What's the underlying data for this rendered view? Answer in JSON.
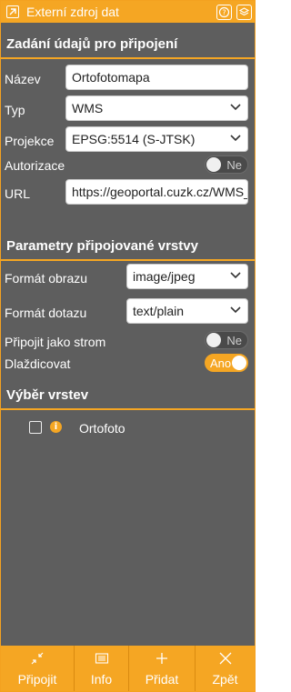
{
  "window": {
    "title": "Externí zdroj dat",
    "icons": [
      "window-icon",
      "help-icon",
      "layers-icon"
    ]
  },
  "connection": {
    "heading": "Zadání údajů pro připojení",
    "name_label": "Název",
    "name_value": "Ortofotomapa",
    "type_label": "Typ",
    "type_value": "WMS",
    "projection_label": "Projekce",
    "projection_value": "EPSG:5514 (S-JTSK)",
    "auth_label": "Autorizace",
    "auth_toggle": "Ne",
    "url_label": "URL",
    "url_value": "https://geoportal.cuzk.cz/WMS_"
  },
  "layer_params": {
    "heading": "Parametry připojované vrstvy",
    "image_format_label": "Formát obrazu",
    "image_format_value": "image/jpeg",
    "query_format_label": "Formát dotazu",
    "query_format_value": "text/plain",
    "as_tree_label": "Připojit jako strom",
    "as_tree_toggle": "Ne",
    "tile_label": "Dlaždicovat",
    "tile_toggle": "Ano"
  },
  "layers": {
    "heading": "Výběr vrstev",
    "items": [
      {
        "name": "Ortofoto",
        "checked": false
      }
    ]
  },
  "footer": {
    "buttons": [
      {
        "label": "Připojit",
        "icon": "compress-icon"
      },
      {
        "label": "Info",
        "icon": "info-card-icon"
      },
      {
        "label": "Přidat",
        "icon": "plus-icon"
      },
      {
        "label": "Zpět",
        "icon": "close-icon"
      }
    ]
  },
  "colors": {
    "accent": "#f5a623",
    "panel": "#5e5e5e"
  }
}
